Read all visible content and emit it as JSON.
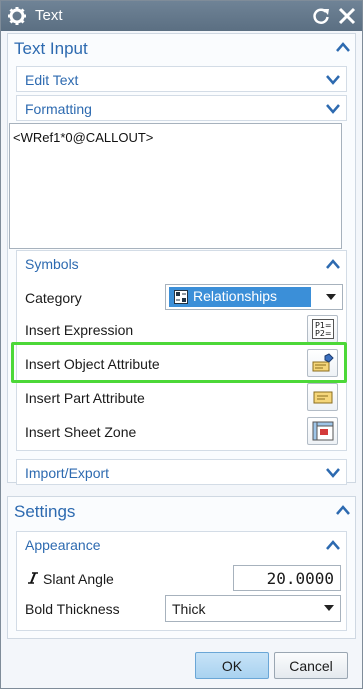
{
  "window": {
    "title": "Text"
  },
  "text_input": {
    "header": "Text Input",
    "edit_text": "Edit Text",
    "formatting": "Formatting",
    "text_value": "<WRef1*0@CALLOUT>"
  },
  "symbols": {
    "header": "Symbols",
    "category_label": "Category",
    "category_value": "Relationships",
    "insert_expression": "Insert Expression",
    "insert_object_attribute": "Insert Object Attribute",
    "insert_part_attribute": "Insert Part Attribute",
    "insert_sheet_zone": "Insert Sheet Zone"
  },
  "import_export": {
    "header": "Import/Export"
  },
  "settings": {
    "header": "Settings",
    "appearance": "Appearance",
    "slant_angle_label": "Slant Angle",
    "slant_angle_value": "20.0000",
    "bold_thickness_label": "Bold Thickness",
    "bold_thickness_value": "Thick"
  },
  "footer": {
    "ok": "OK",
    "cancel": "Cancel"
  },
  "colors": {
    "accent": "#2d6ab0",
    "highlight": "#4cd838",
    "titlebar": "#5b6f82"
  }
}
